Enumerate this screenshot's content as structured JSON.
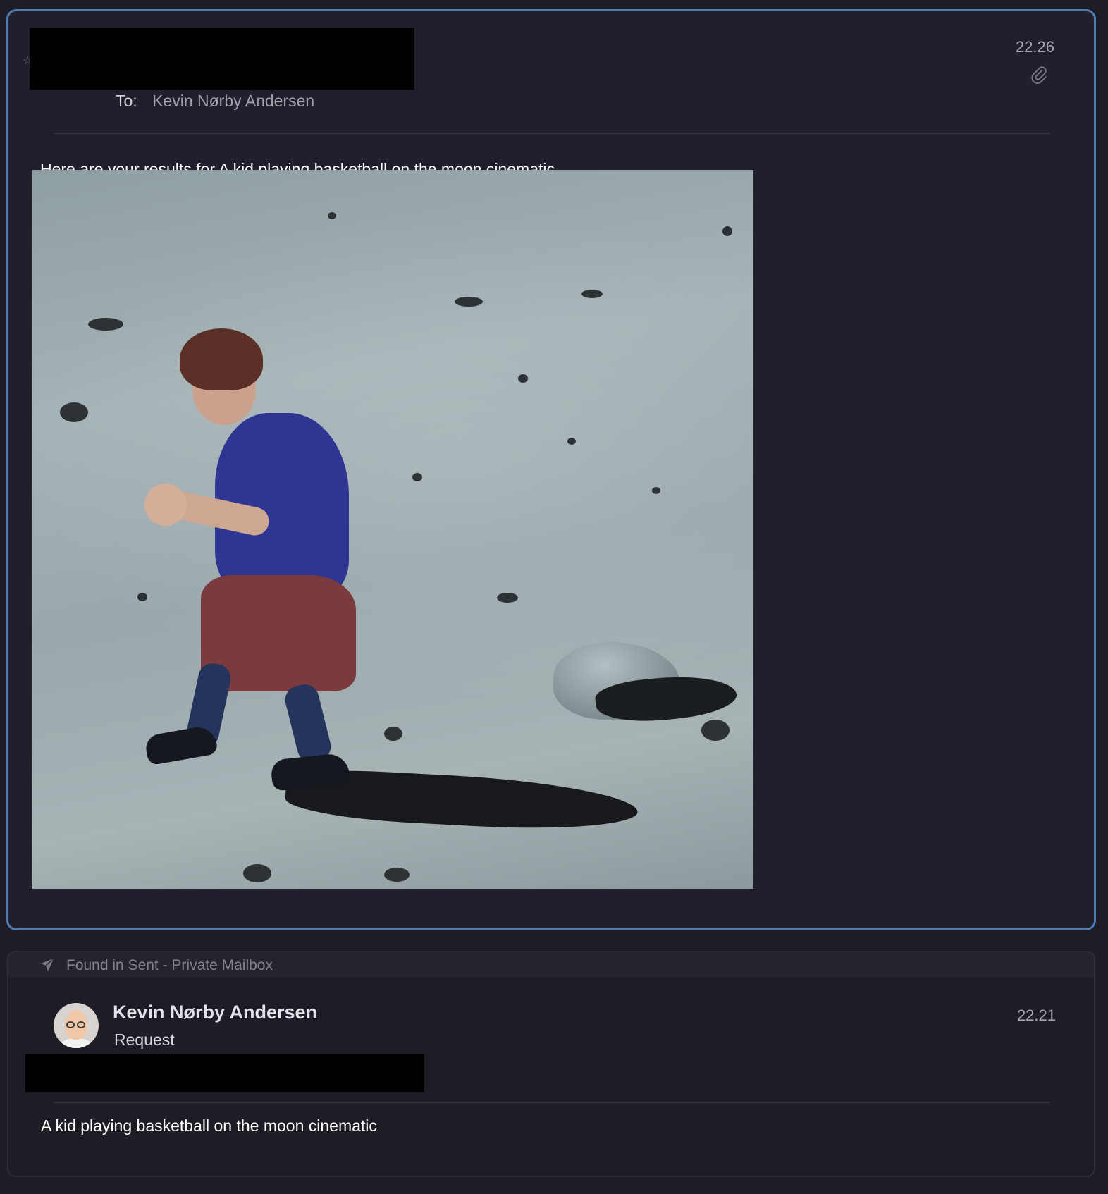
{
  "selected_message": {
    "time": "22.26",
    "to_label": "To:",
    "to_name": "Kevin Nørby Andersen",
    "body_text": "Here are your results for A kid playing basketball on the moon cinematic",
    "attachment_icon": "paperclip-icon"
  },
  "related_message": {
    "found_in": "Found in Sent - Private Mailbox",
    "found_icon": "paper-plane-icon",
    "sender_name": "Kevin Nørby Andersen",
    "subject": "Request",
    "time": "22.21",
    "body_text": "A kid playing basketball on the moon cinematic"
  },
  "colors": {
    "background": "#1e1c26",
    "selection_border": "#4c7cb3",
    "text_primary": "#ffffff",
    "text_secondary": "#a9a6b2"
  }
}
